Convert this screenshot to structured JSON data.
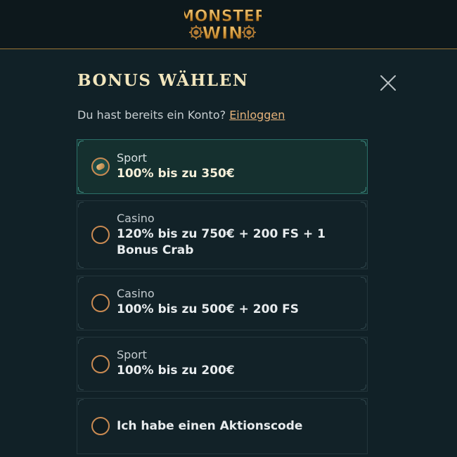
{
  "header": {
    "logo_line1": "MONSTER",
    "logo_line2": "WIN",
    "accent_color": "#9a7535"
  },
  "modal": {
    "title": "BONUS WÄHLEN",
    "login_prompt": "Du hast bereits ein Konto?",
    "login_link": "Einloggen"
  },
  "options": [
    {
      "category": "Sport",
      "title": "100% bis zu 350€",
      "selected": true
    },
    {
      "category": "Casino",
      "title": "120% bis zu 750€ + 200 FS + 1 Bonus Crab",
      "selected": false
    },
    {
      "category": "Casino",
      "title": "100% bis zu 500€ + 200 FS",
      "selected": false
    },
    {
      "category": "Sport",
      "title": "100% bis zu 200€",
      "selected": false
    },
    {
      "category": "",
      "title": "Ich habe einen Aktionscode",
      "selected": false
    }
  ],
  "icons": {
    "close": "close-icon",
    "radio": "radio-icon"
  }
}
